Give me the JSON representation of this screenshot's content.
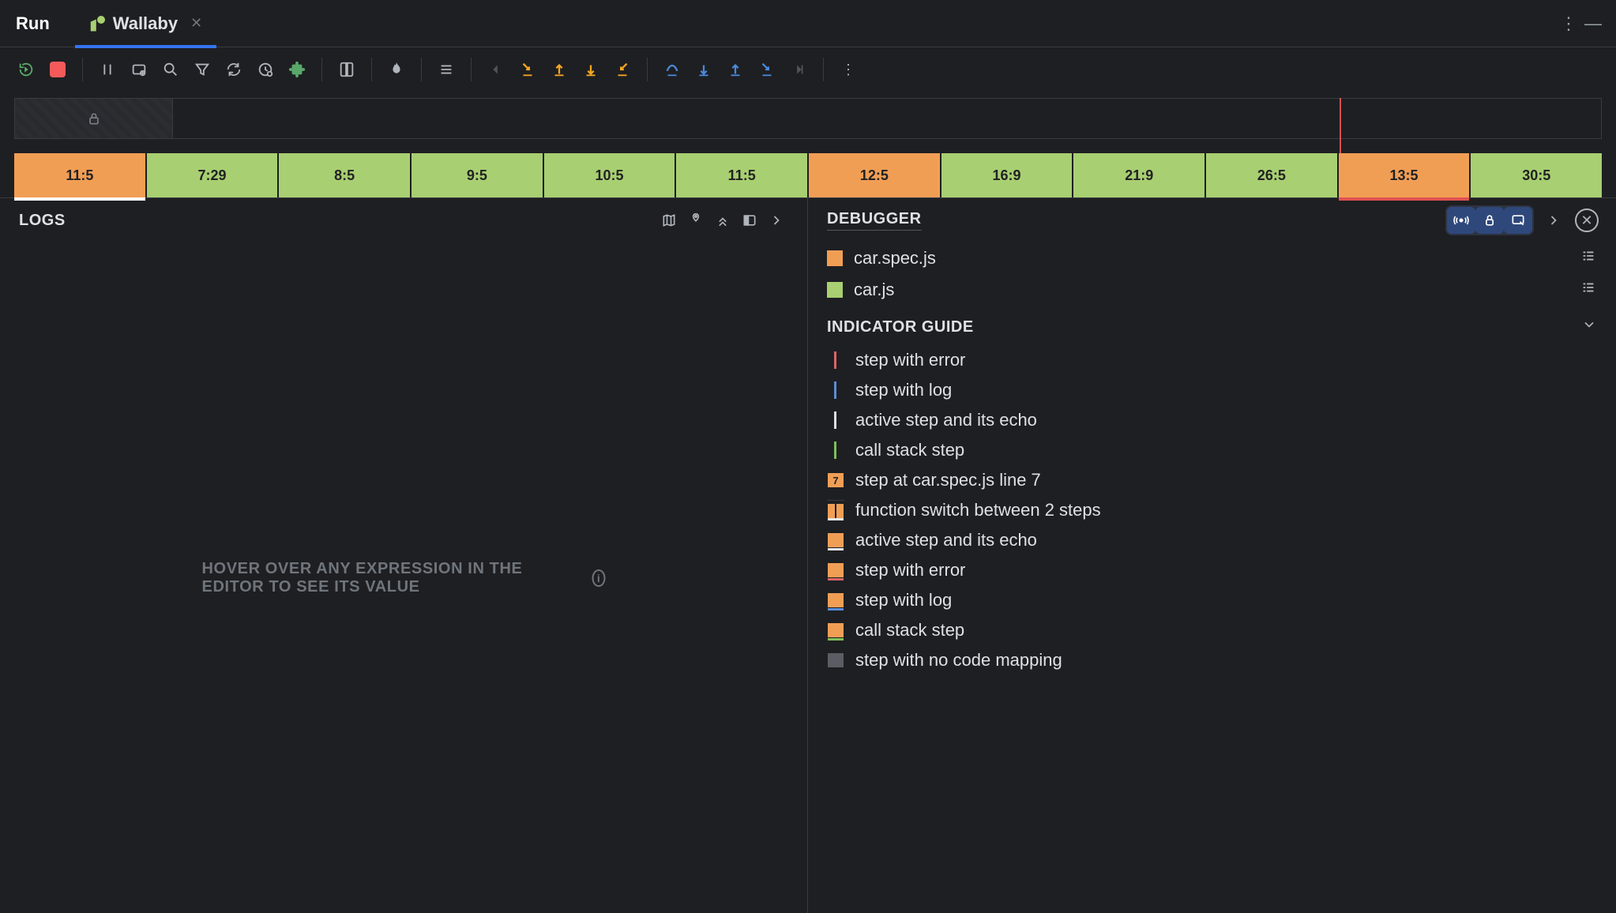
{
  "titlebar": {
    "run_label": "Run",
    "tab_label": "Wallaby"
  },
  "timeline": {
    "steps": [
      {
        "label": "11:5",
        "color": "orange",
        "underline": "white"
      },
      {
        "label": "7:29",
        "color": "green",
        "underline": null
      },
      {
        "label": "8:5",
        "color": "green",
        "underline": null
      },
      {
        "label": "9:5",
        "color": "green",
        "underline": null
      },
      {
        "label": "10:5",
        "color": "green",
        "underline": null
      },
      {
        "label": "11:5",
        "color": "green",
        "underline": null
      },
      {
        "label": "12:5",
        "color": "orange",
        "underline": null
      },
      {
        "label": "16:9",
        "color": "green",
        "underline": null
      },
      {
        "label": "21:9",
        "color": "green",
        "underline": null
      },
      {
        "label": "26:5",
        "color": "green",
        "underline": null
      },
      {
        "label": "13:5",
        "color": "orange",
        "underline": "red"
      },
      {
        "label": "30:5",
        "color": "green",
        "underline": null
      }
    ],
    "marker_index": 10
  },
  "logs_panel": {
    "title": "LOGS",
    "placeholder": "HOVER OVER ANY EXPRESSION IN THE EDITOR TO SEE ITS VALUE"
  },
  "debugger_panel": {
    "title": "DEBUGGER",
    "files": [
      {
        "name": "car.spec.js",
        "color": "orange"
      },
      {
        "name": "car.js",
        "color": "green"
      }
    ],
    "indicator_guide_title": "INDICATOR GUIDE",
    "guide": [
      {
        "kind": "vbar",
        "color": "red",
        "label": "step with error"
      },
      {
        "kind": "vbar",
        "color": "blue",
        "label": "step with log"
      },
      {
        "kind": "vbar",
        "color": "white",
        "label": "active step and its echo"
      },
      {
        "kind": "vbar",
        "color": "green",
        "label": "call stack step"
      },
      {
        "kind": "sq",
        "num": "7",
        "under": "none",
        "label": "step at car.spec.js line 7"
      },
      {
        "kind": "split",
        "label": "function switch between 2 steps"
      },
      {
        "kind": "sq",
        "under": "white",
        "label": "active step and its echo"
      },
      {
        "kind": "sq",
        "under": "red",
        "label": "step with error"
      },
      {
        "kind": "sq",
        "under": "blue",
        "label": "step with log"
      },
      {
        "kind": "sq",
        "under": "green",
        "label": "call stack step"
      },
      {
        "kind": "sq",
        "grey": true,
        "under": "none",
        "label": "step with no code mapping"
      }
    ]
  }
}
